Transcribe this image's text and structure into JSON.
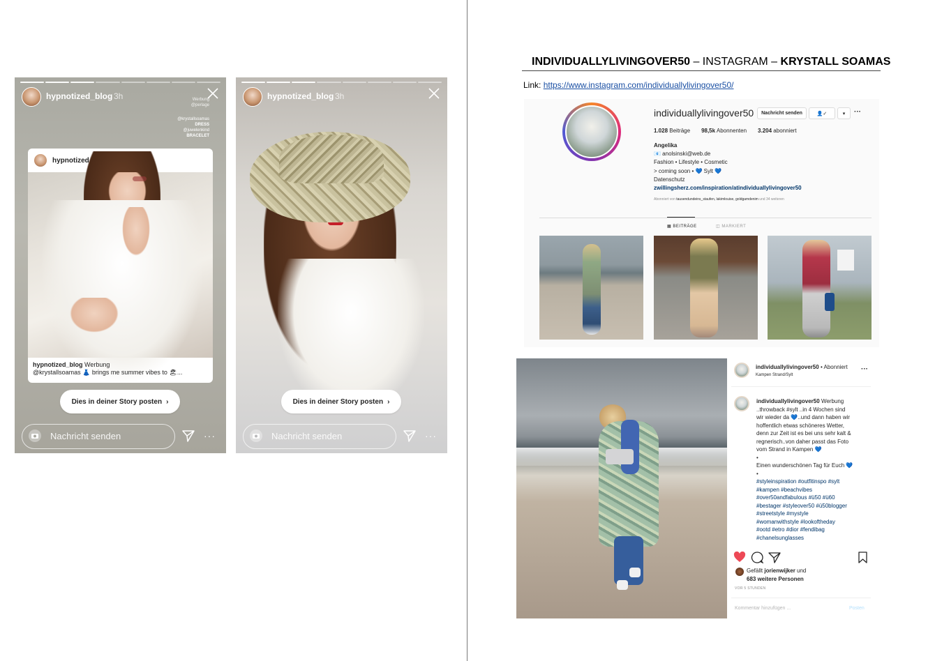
{
  "story1": {
    "username": "hypnotized_blog",
    "time": "3h",
    "werbung": "Werbung",
    "werbung_tag": "@perlage",
    "tags": [
      "@krystallsoamas",
      "DRESS",
      "@juwelenkind",
      "BRACELET"
    ],
    "card_username": "hypnotized_blog",
    "caption_user": "hypnotized_blog",
    "caption_werbung": "Werbung",
    "caption_text": "@krystallsoamas 👗 brings me summer vibes to 🏖...",
    "post_button": "Dies in deiner Story posten",
    "message_placeholder": "Nachricht senden",
    "more": "···"
  },
  "story2": {
    "username": "hypnotized_blog",
    "time": "3h",
    "post_button": "Dies in deiner Story posten",
    "message_placeholder": "Nachricht senden",
    "more": "···"
  },
  "document": {
    "title_account": "INDIVIDUALLYLIVINGOVER50",
    "title_sep1": " – INSTAGRAM – ",
    "title_brand": "KRYSTALL SOAMAS",
    "link_label": "Link: ",
    "link_url": "https://www.instagram.com/individuallylivingover50/"
  },
  "profile": {
    "username": "individuallylivingover50",
    "message_button": "Nachricht senden",
    "follow_icon": "👤✓",
    "dropdown": "▾",
    "more": "···",
    "posts": "1.028",
    "posts_label": "Beiträge",
    "followers": "98,5k",
    "followers_label": "Abonnenten",
    "following": "3.204",
    "following_label": "abonniert",
    "name": "Angelika",
    "bio_email": "📧 anolsinski@web.de",
    "bio_line2": "Fashion • Lifestyle • Cosmetic",
    "bio_line3": "> coming soon • 💙 Sylt 💙",
    "bio_line4": "Datenschutz",
    "bio_link": "zwillingsherz.com/inspiration/atindividuallylivingover50",
    "followed_by_prefix": "Abonniert von ",
    "followed_by_names": "tausendundeins_staufen, lakimlouise, goldgamdenim",
    "followed_by_suffix": " und 34 weiteren",
    "tab_posts": "▦ BEITRÄGE",
    "tab_tagged": "◫ MARKIERT"
  },
  "post": {
    "username": "individuallylivingover50",
    "follow_state": "• Abonniert",
    "location": "Kampen Strand/Sylt",
    "more": "···",
    "caption_user": "individuallylivingover50",
    "caption_lines": [
      "Werbung",
      "..throwback #sylt ..in 4 Wochen sind",
      "wir wieder da 💙..und dann haben wir",
      "hoffentlich etwas schöneres Wetter,",
      "denn zur Zeit ist es bei uns sehr kalt &",
      "regnerisch..von daher passt das Foto",
      "vom Strand in Kampen 💙",
      "•",
      "Einen wunderschönen Tag für Euch 💙",
      "•"
    ],
    "hashtags": [
      "#styleinspiration #outfitinspo #sylt",
      "#kampen #beachvibes",
      "#over50andfabulous #ü50 #ü60",
      "#bestager #styleover50 #ü50blogger",
      "#streetstyle #mystyle",
      "#womanwithstyle #lookoftheday",
      "#ootd #etro #dior #fendibag",
      "#chanelsunglasses"
    ],
    "likes_prefix": "Gefällt ",
    "likes_user": "jorienwijker",
    "likes_mid": " und",
    "likes_count": "683 weitere Personen",
    "time": "VOR 5 STUNDEN",
    "comment_placeholder": "Kommentar hinzufügen ...",
    "post_button": "Posten"
  },
  "colors": {
    "link": "#1a4fa3",
    "heart": "#ed4956",
    "hashtag": "#003569"
  }
}
